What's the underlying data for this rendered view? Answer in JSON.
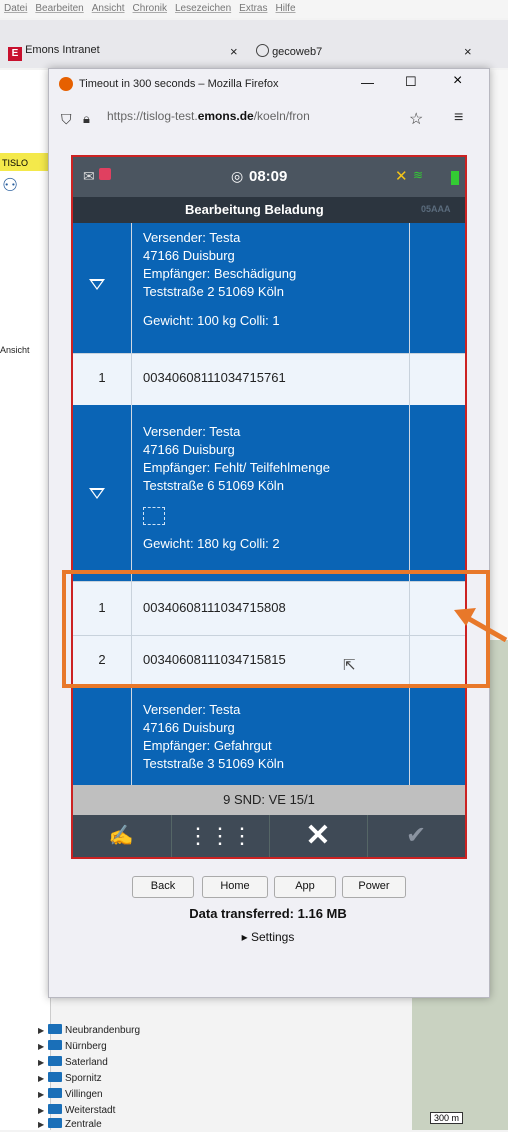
{
  "menu": [
    "Datei",
    "Bearbeiten",
    "Ansicht",
    "Chronik",
    "Lesezeichen",
    "Extras",
    "Hilfe"
  ],
  "tabs": [
    {
      "label": "Emons Intranet",
      "close": "×"
    },
    {
      "label": "gecoweb7",
      "close": "×"
    }
  ],
  "left_panel": {
    "toolbar_label": "TISLO",
    "ansicht": "Ansicht",
    "tree_items": [
      "Neubrandenburg",
      "Nürnberg",
      "Saterland",
      "Spornitz",
      "Villingen",
      "Weiterstadt",
      "Zentrale"
    ]
  },
  "map": {
    "scale": "300 m"
  },
  "popup": {
    "title": "Timeout in 300 seconds – Mozilla Firefox",
    "url_prefix": "https://tislog-test.",
    "url_domain": "emons.de",
    "url_suffix": "/koeln/fron",
    "controls": {
      "minimize": "—",
      "maximize": "☐",
      "close": "×"
    }
  },
  "app": {
    "time": "08:09",
    "title": "Bearbeitung Beladung",
    "title_right": "05AAA",
    "shipments": [
      {
        "sender": "Versender: Testa",
        "city": "47166 Duisburg",
        "receiver": "Empfänger: Beschädigung",
        "address": "Teststraße 2 51069 Köln",
        "weight": "Gewicht: 100 kg Colli: 1"
      },
      {
        "sender": "Versender: Testa",
        "city": "47166 Duisburg",
        "receiver": "Empfänger: Fehlt/ Teilfehlmenge",
        "address": "Teststraße 6 51069 Köln",
        "weight": "Gewicht: 180 kg Colli: 2"
      },
      {
        "sender": "Versender: Testa",
        "city": "47166 Duisburg",
        "receiver": "Empfänger: Gefahrgut",
        "address": "Teststraße 3 51069 Köln"
      }
    ],
    "rows": [
      {
        "num": "1",
        "code": "00340608111034715761"
      },
      {
        "num": "1",
        "code": "00340608111034715808"
      },
      {
        "num": "2",
        "code": "00340608111034715815"
      }
    ],
    "snd_bar": "9 SND: VE 15/1"
  },
  "bottom": {
    "buttons": [
      "Back",
      "Home",
      "App",
      "Power"
    ],
    "transfer": "Data transferred: 1.16 MB",
    "settings": "▸ Settings"
  },
  "colors": {
    "accent": "#0a64b5",
    "highlight": "#e8782a"
  }
}
